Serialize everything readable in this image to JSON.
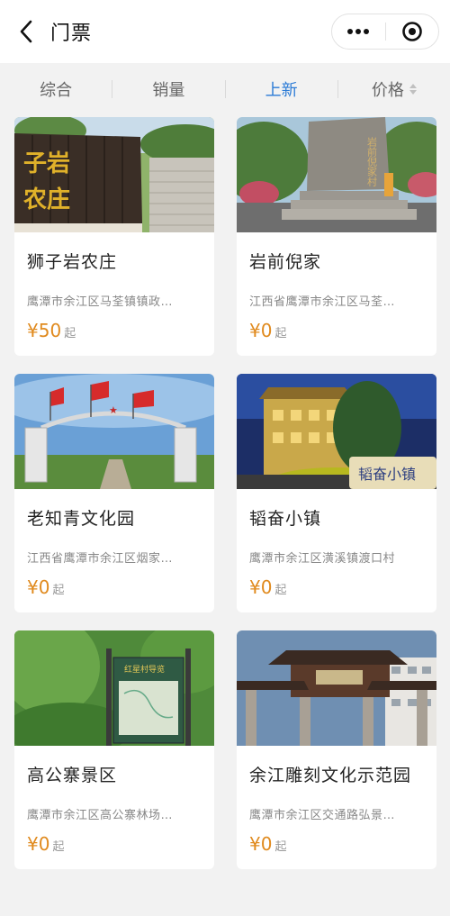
{
  "header": {
    "title": "门票"
  },
  "tabs": [
    {
      "label": "综合"
    },
    {
      "label": "销量"
    },
    {
      "label": "上新"
    },
    {
      "label": "价格"
    }
  ],
  "active_tab": "上新",
  "colors": {
    "accent": "#2b7bd6",
    "price": "#e08a1e",
    "background": "#f2f2f2"
  },
  "cards": [
    {
      "name": "狮子岩农庄",
      "address": "鹰潭市余江区马荃镇镇政…",
      "price": "¥50",
      "unit": "起",
      "thumb_text": "子岩 农庄"
    },
    {
      "name": "岩前倪家",
      "address": "江西省鹰潭市余江区马荃…",
      "price": "¥0",
      "unit": "起",
      "thumb_text": "岩前倪家村"
    },
    {
      "name": "老知青文化园",
      "address": "江西省鹰潭市余江区烟家…",
      "price": "¥0",
      "unit": "起",
      "thumb_text": ""
    },
    {
      "name": "韬奋小镇",
      "address": "鹰潭市余江区潢溪镇渡口村",
      "price": "¥0",
      "unit": "起",
      "thumb_text": "韬奋小镇"
    },
    {
      "name": "高公寨景区",
      "address": "鹰潭市余江区高公寨林场…",
      "price": "¥0",
      "unit": "起",
      "thumb_text": "红星村导览"
    },
    {
      "name": "余江雕刻文化示范园",
      "address": "鹰潭市余江区交通路弘景…",
      "price": "¥0",
      "unit": "起",
      "thumb_text": ""
    }
  ]
}
